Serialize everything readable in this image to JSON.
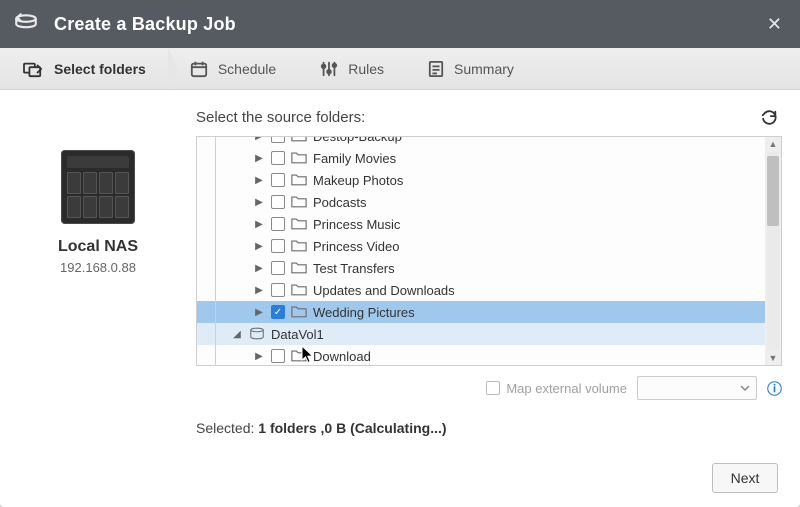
{
  "titlebar": {
    "title": "Create a Backup Job"
  },
  "steps": {
    "select_folders": "Select folders",
    "schedule": "Schedule",
    "rules": "Rules",
    "summary": "Summary"
  },
  "nas": {
    "name": "Local NAS",
    "ip": "192.168.0.88"
  },
  "main": {
    "heading": "Select the source folders:",
    "map_label": "Map external volume",
    "selected_prefix": "Selected: ",
    "selected_value": "1 folders ,0 B (Calculating...)"
  },
  "tree": {
    "items": [
      {
        "label": "Destop-Backup",
        "checked": false,
        "depth": 2,
        "type": "folder",
        "caret": "▶",
        "state": ""
      },
      {
        "label": "Family Movies",
        "checked": false,
        "depth": 2,
        "type": "folder",
        "caret": "▶",
        "state": ""
      },
      {
        "label": "Makeup Photos",
        "checked": false,
        "depth": 2,
        "type": "folder",
        "caret": "▶",
        "state": ""
      },
      {
        "label": "Podcasts",
        "checked": false,
        "depth": 2,
        "type": "folder",
        "caret": "▶",
        "state": ""
      },
      {
        "label": "Princess Music",
        "checked": false,
        "depth": 2,
        "type": "folder",
        "caret": "▶",
        "state": ""
      },
      {
        "label": "Princess Video",
        "checked": false,
        "depth": 2,
        "type": "folder",
        "caret": "▶",
        "state": ""
      },
      {
        "label": "Test Transfers",
        "checked": false,
        "depth": 2,
        "type": "folder",
        "caret": "▶",
        "state": ""
      },
      {
        "label": "Updates and Downloads",
        "checked": false,
        "depth": 2,
        "type": "folder",
        "caret": "▶",
        "state": ""
      },
      {
        "label": "Wedding Pictures",
        "checked": true,
        "depth": 2,
        "type": "folder",
        "caret": "▶",
        "state": "sel"
      },
      {
        "label": "DataVol1",
        "checked": null,
        "depth": 1,
        "type": "volume",
        "caret": "◢",
        "state": "sub"
      },
      {
        "label": "Download",
        "checked": false,
        "depth": 2,
        "type": "folder",
        "caret": "▶",
        "state": ""
      }
    ]
  },
  "footer": {
    "next": "Next"
  }
}
